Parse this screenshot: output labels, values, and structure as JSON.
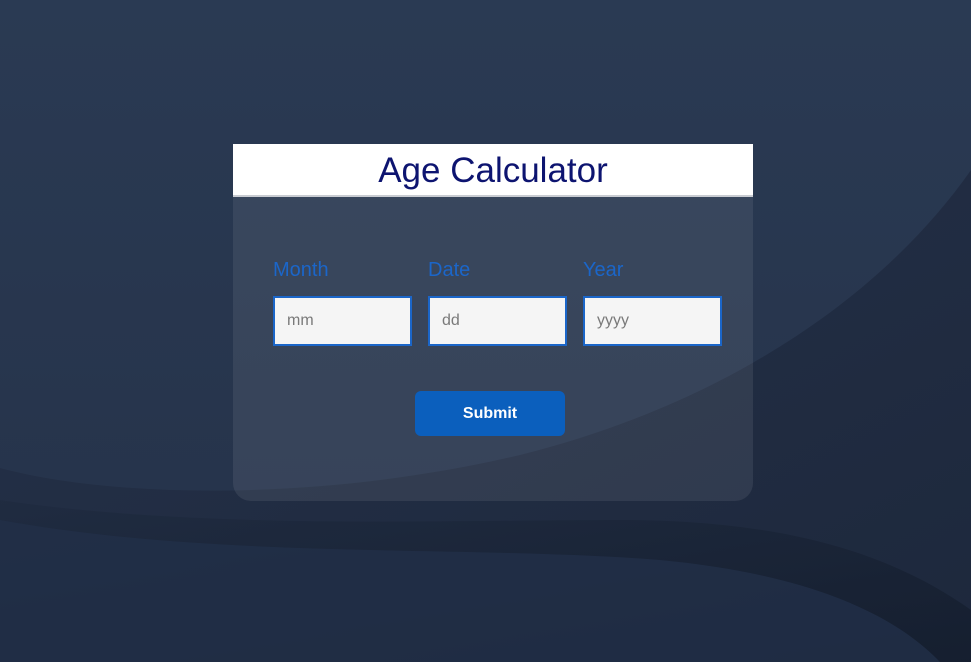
{
  "header": {
    "title": "Age Calculator"
  },
  "fields": [
    {
      "label": "Month",
      "placeholder": "mm",
      "value": ""
    },
    {
      "label": "Date",
      "placeholder": "dd",
      "value": ""
    },
    {
      "label": "Year",
      "placeholder": "yyyy",
      "value": ""
    }
  ],
  "actions": {
    "submit_label": "Submit"
  },
  "colors": {
    "background": "#2b3a52",
    "title": "#0d1470",
    "accent": "#1b66c9",
    "button": "#0b5fbd"
  }
}
